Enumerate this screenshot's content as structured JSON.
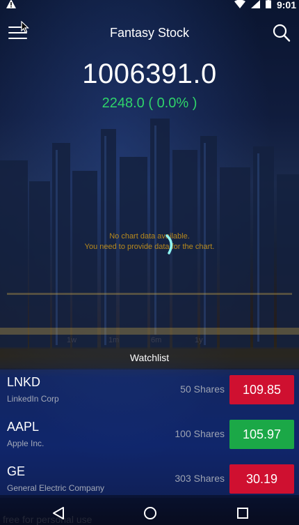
{
  "status_bar": {
    "time": "9:01",
    "alert_icon": "warning-icon",
    "wifi_icon": "wifi-icon",
    "signal_icon": "signal-icon",
    "battery_icon": "battery-icon"
  },
  "app_bar": {
    "title": "Fantasy Stock",
    "menu_icon": "hamburger-menu-icon",
    "search_icon": "search-icon"
  },
  "portfolio": {
    "value": "1006391.0",
    "change": "2248.0 ( 0.0% )",
    "change_color": "#2fd36a"
  },
  "chart": {
    "no_data_line1": "No chart data available.",
    "no_data_line2": "You need to provide data for the chart.",
    "no_data_color": "#b88a1e",
    "range_labels": [
      "1w",
      "1m",
      "6m",
      "1y"
    ]
  },
  "watchlist": {
    "title": "Watchlist",
    "items": [
      {
        "symbol": "LNKD",
        "name": "LinkedIn Corp",
        "shares": "50 Shares",
        "price": "109.85",
        "color": "#cf1030"
      },
      {
        "symbol": "AAPL",
        "name": "Apple Inc.",
        "shares": "100 Shares",
        "price": "105.97",
        "color": "#1ba847"
      },
      {
        "symbol": "GE",
        "name": "General Electric Company",
        "shares": "303 Shares",
        "price": "30.19",
        "color": "#cf1030"
      }
    ]
  },
  "nav_bar": {
    "back_icon": "back-triangle-icon",
    "home_icon": "home-circle-icon",
    "recents_icon": "recents-square-icon"
  },
  "watermark": "free for personal use"
}
